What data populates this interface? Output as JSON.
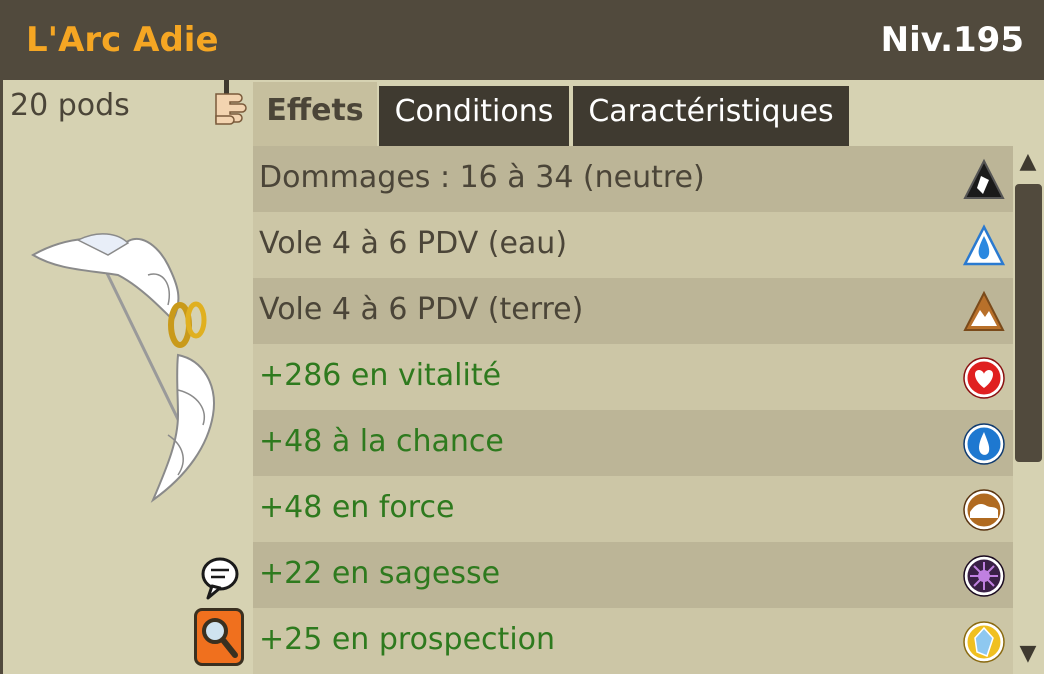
{
  "item": {
    "name": "L'Arc Adie",
    "level": "Niv.195",
    "weight": "20 pods"
  },
  "tabs": [
    {
      "label": "Effets",
      "active": true
    },
    {
      "label": "Conditions",
      "active": false
    },
    {
      "label": "Caractéristiques",
      "active": false
    }
  ],
  "effects": [
    {
      "text": "Dommages : 16 à 34 (neutre)",
      "color": "#4b4538",
      "icon": "neutral-element-icon"
    },
    {
      "text": "Vole 4 à 6 PDV (eau)",
      "color": "#4b4538",
      "icon": "water-element-icon"
    },
    {
      "text": "Vole 4 à 6 PDV (terre)",
      "color": "#4b4538",
      "icon": "earth-element-icon"
    },
    {
      "text": "+286 en vitalité",
      "color": "#2e7a1e",
      "icon": "vitality-icon"
    },
    {
      "text": "+48 à la chance",
      "color": "#2e7a1e",
      "icon": "chance-icon"
    },
    {
      "text": "+48 en force",
      "color": "#2e7a1e",
      "icon": "strength-icon"
    },
    {
      "text": "+22 en sagesse",
      "color": "#2e7a1e",
      "icon": "wisdom-icon"
    },
    {
      "text": "+25 en prospection",
      "color": "#2e7a1e",
      "icon": "prospecting-icon"
    }
  ],
  "colors": {
    "header_bg": "#514a3d",
    "title": "#f5a623",
    "bonus_text": "#2e7a1e",
    "panel_bg": "#d6d2b2"
  },
  "scrollbar": {
    "up_glyph": "▲",
    "down_glyph": "▼"
  }
}
